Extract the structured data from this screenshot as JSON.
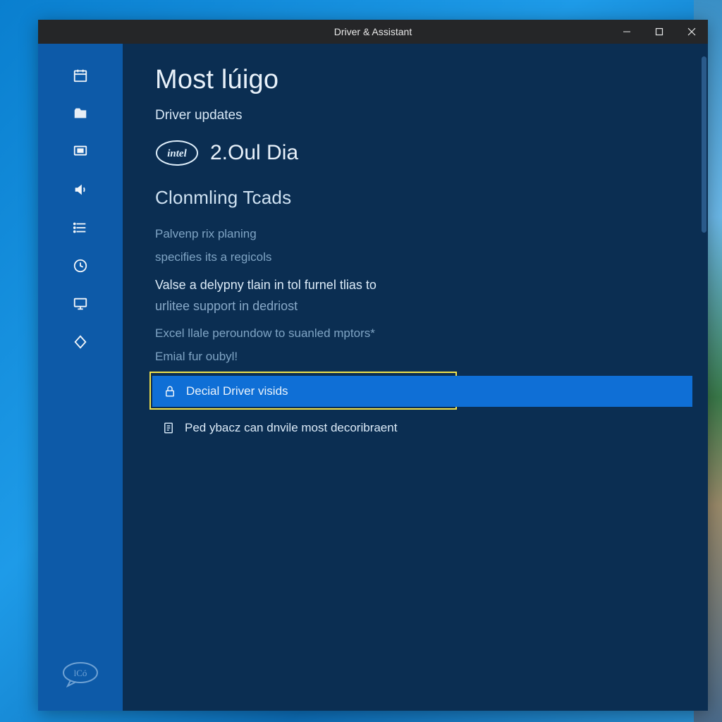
{
  "window": {
    "title": "Driver & Assistant"
  },
  "main": {
    "title": "Most lúigo",
    "subtitle": "Driver updates",
    "brand_logo_text": "intel",
    "version": "2.Oul Dia",
    "section_heading": "Clonmling Tcads",
    "paragraphs": {
      "p1a": "Palvenp rix planing",
      "p1b": "specifies its a regicols",
      "p2a": "Valse a delypny tlain in tol furnel tlias to",
      "p2b": "urlitee support in dedriost",
      "p3": "Excel llale peroundow to suanled mptors*",
      "p4": "Emial fur oubyl!"
    },
    "rows": {
      "highlighted": "Decial Driver visids",
      "secondary": "Ped ybacz can dnvile most decoribraent"
    }
  },
  "sidebar": {
    "icons": [
      "calendar-icon",
      "folder-icon",
      "monitor-icon",
      "volume-icon",
      "list-icon",
      "history-icon",
      "display-icon",
      "diamond-icon"
    ],
    "bottom_logo_text": "lCó"
  }
}
